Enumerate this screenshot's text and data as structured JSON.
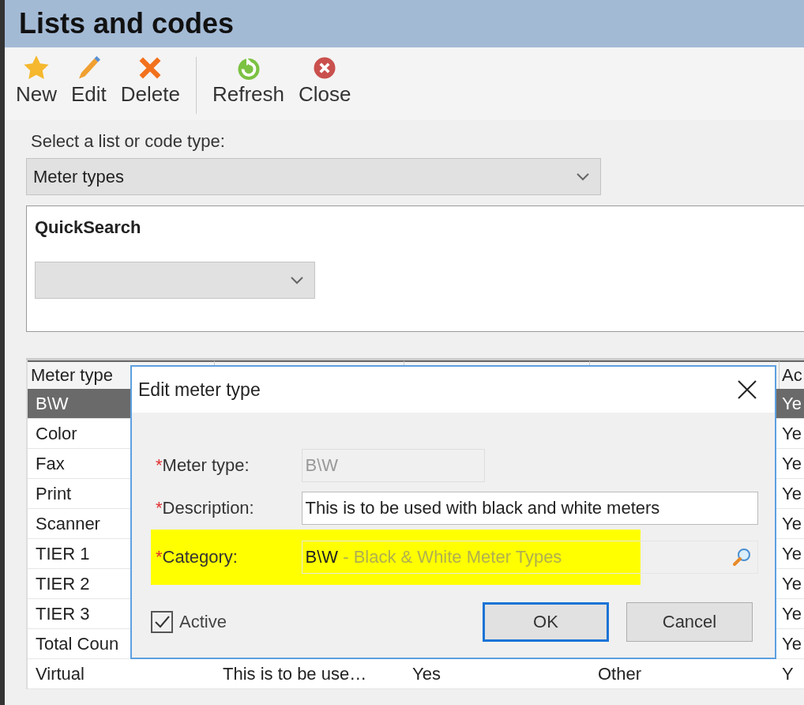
{
  "window": {
    "title": "Lists and codes"
  },
  "toolbar": [
    {
      "kind": "button",
      "label": "New"
    },
    {
      "kind": "button",
      "label": "Edit"
    },
    {
      "kind": "button",
      "label": "Delete"
    },
    {
      "kind": "separator"
    },
    {
      "kind": "button",
      "label": "Refresh"
    },
    {
      "kind": "button",
      "label": "Close"
    }
  ],
  "list_type": {
    "label": "Select a list or code type:",
    "value": "Meter types"
  },
  "quick_search": {
    "title": "QuickSearch"
  },
  "table": {
    "columns": [
      {
        "label": "Meter type"
      },
      {
        "label": "Ac"
      }
    ],
    "rows": [
      {
        "name": "B\\W",
        "active": "Ye",
        "selected": true
      },
      {
        "name": "Color",
        "active": "Ye",
        "selected": false
      },
      {
        "name": "Fax",
        "active": "Ye",
        "selected": false
      },
      {
        "name": "Print",
        "active": "Ye",
        "selected": false
      },
      {
        "name": "Scanner",
        "active": "Ye",
        "selected": false
      },
      {
        "name": "TIER 1",
        "active": "Ye",
        "selected": false
      },
      {
        "name": "TIER 2",
        "active": "Ye",
        "selected": false
      },
      {
        "name": "TIER 3",
        "active": "Ye",
        "selected": false
      },
      {
        "name": "Total Coun",
        "active": "Ye",
        "selected": false
      },
      {
        "name": "Virtual",
        "column_2": "This is to be use…",
        "column_3": "Yes",
        "column_4": "Other",
        "active": "Y",
        "selected": false
      }
    ]
  },
  "dialog": {
    "title": "Edit meter type",
    "fields": [
      {
        "label": "Meter type:",
        "required_mark": "*",
        "value": "B\\W",
        "disabled": true,
        "kind": "short"
      },
      {
        "label": "Description:",
        "required_mark": "*",
        "value": "This is to be used with black and white meters",
        "disabled": false,
        "kind": "text"
      },
      {
        "label": "Category:",
        "required_mark": "*",
        "value": "B\\W",
        "detail": " - Black & White Meter Types",
        "kind": "lookup",
        "highlighted": true
      }
    ],
    "active": {
      "label": "Active",
      "checked": true
    },
    "buttons": [
      {
        "label": "OK",
        "default": true
      },
      {
        "label": "Cancel",
        "default": false
      }
    ]
  }
}
